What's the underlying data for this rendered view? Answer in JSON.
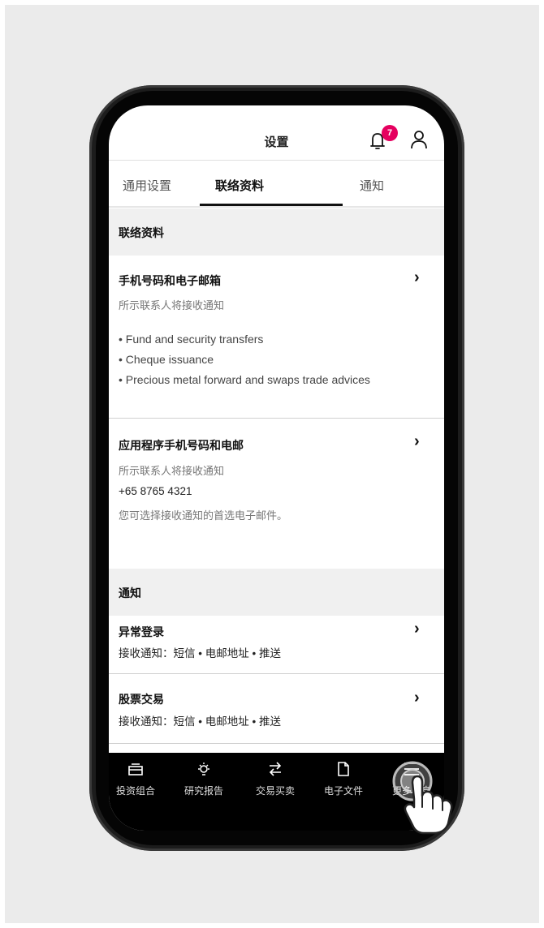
{
  "header": {
    "title": "设置",
    "notification_count": "7"
  },
  "tabs": [
    {
      "label": "通用设置",
      "active": false
    },
    {
      "label": "联络资料",
      "active": true
    },
    {
      "label": "通知",
      "active": false
    }
  ],
  "contact_section": {
    "heading": "联络资料",
    "mobile_email": {
      "title": "手机号码和电子邮箱",
      "subtitle": "所示联系人将接收通知",
      "bullets": [
        "• Fund and security transfers",
        "• Cheque issuance",
        "• Precious metal forward and swaps trade advices"
      ]
    },
    "app_contact": {
      "title": "应用程序手机号码和电邮",
      "subtitle": "所示联系人将接收通知",
      "phone": "+65 8765 4321",
      "note": "您可选择接收通知的首选电子邮件。"
    }
  },
  "notification_section": {
    "heading": "通知",
    "items": [
      {
        "title": "异常登录",
        "detail": "接收通知：短信 • 电邮地址 • 推送"
      },
      {
        "title": "股票交易",
        "detail": "接收通知：短信 • 电邮地址 • 推送"
      }
    ]
  },
  "bottom_nav": [
    {
      "label": "投资组合",
      "icon": "portfolio-icon"
    },
    {
      "label": "研究报告",
      "icon": "lightbulb-icon"
    },
    {
      "label": "交易买卖",
      "icon": "trade-arrows-icon"
    },
    {
      "label": "电子文件",
      "icon": "document-icon"
    },
    {
      "label": "更多信息",
      "icon": "menu-icon"
    }
  ],
  "colors": {
    "badge": "#e5005f",
    "nav_background": "#000000",
    "section_background": "#f0f0f0"
  }
}
